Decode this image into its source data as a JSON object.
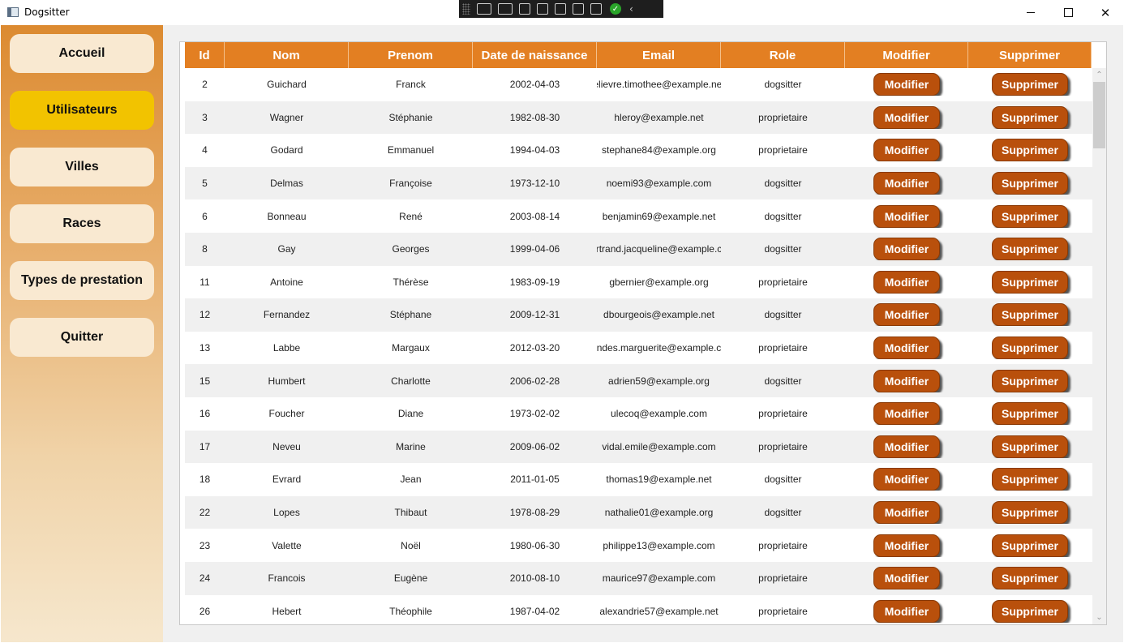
{
  "window": {
    "title": "Dogsitter"
  },
  "sidebar": {
    "items": [
      {
        "label": "Accueil",
        "active": false
      },
      {
        "label": "Utilisateurs",
        "active": true
      },
      {
        "label": "Villes",
        "active": false
      },
      {
        "label": "Races",
        "active": false
      },
      {
        "label": "Types de prestation",
        "active": false
      },
      {
        "label": "Quitter",
        "active": false
      }
    ]
  },
  "grid": {
    "columns": [
      "Id",
      "Nom",
      "Prenom",
      "Date de naissance",
      "Email",
      "Role",
      "Modifier",
      "Supprimer"
    ],
    "modify_label": "Modifier",
    "delete_label": "Supprimer",
    "rows": [
      {
        "id": "2",
        "nom": "Guichard",
        "prenom": "Franck",
        "date": "2002-04-03",
        "email": "elievre.timothee@example.net",
        "role": "dogsitter"
      },
      {
        "id": "3",
        "nom": "Wagner",
        "prenom": "Stéphanie",
        "date": "1982-08-30",
        "email": "hleroy@example.net",
        "role": "proprietaire"
      },
      {
        "id": "4",
        "nom": "Godard",
        "prenom": "Emmanuel",
        "date": "1994-04-03",
        "email": "stephane84@example.org",
        "role": "proprietaire"
      },
      {
        "id": "5",
        "nom": "Delmas",
        "prenom": "Françoise",
        "date": "1973-12-10",
        "email": "noemi93@example.com",
        "role": "dogsitter"
      },
      {
        "id": "6",
        "nom": "Bonneau",
        "prenom": "René",
        "date": "2003-08-14",
        "email": "benjamin69@example.net",
        "role": "dogsitter"
      },
      {
        "id": "8",
        "nom": "Gay",
        "prenom": "Georges",
        "date": "1999-04-06",
        "email": "rtrand.jacqueline@example.c",
        "role": "dogsitter"
      },
      {
        "id": "11",
        "nom": "Antoine",
        "prenom": "Thérèse",
        "date": "1983-09-19",
        "email": "gbernier@example.org",
        "role": "proprietaire"
      },
      {
        "id": "12",
        "nom": "Fernandez",
        "prenom": "Stéphane",
        "date": "2009-12-31",
        "email": "dbourgeois@example.net",
        "role": "dogsitter"
      },
      {
        "id": "13",
        "nom": "Labbe",
        "prenom": "Margaux",
        "date": "2012-03-20",
        "email": "ndes.marguerite@example.c",
        "role": "proprietaire"
      },
      {
        "id": "15",
        "nom": "Humbert",
        "prenom": "Charlotte",
        "date": "2006-02-28",
        "email": "adrien59@example.org",
        "role": "dogsitter"
      },
      {
        "id": "16",
        "nom": "Foucher",
        "prenom": "Diane",
        "date": "1973-02-02",
        "email": "ulecoq@example.com",
        "role": "proprietaire"
      },
      {
        "id": "17",
        "nom": "Neveu",
        "prenom": "Marine",
        "date": "2009-06-02",
        "email": "vidal.emile@example.com",
        "role": "proprietaire"
      },
      {
        "id": "18",
        "nom": "Evrard",
        "prenom": "Jean",
        "date": "2011-01-05",
        "email": "thomas19@example.net",
        "role": "dogsitter"
      },
      {
        "id": "22",
        "nom": "Lopes",
        "prenom": "Thibaut",
        "date": "1978-08-29",
        "email": "nathalie01@example.org",
        "role": "dogsitter"
      },
      {
        "id": "23",
        "nom": "Valette",
        "prenom": "Noël",
        "date": "1980-06-30",
        "email": "philippe13@example.com",
        "role": "proprietaire"
      },
      {
        "id": "24",
        "nom": "Francois",
        "prenom": "Eugène",
        "date": "2010-08-10",
        "email": "maurice97@example.com",
        "role": "proprietaire"
      },
      {
        "id": "26",
        "nom": "Hebert",
        "prenom": "Théophile",
        "date": "1987-04-02",
        "email": "alexandrie57@example.net",
        "role": "proprietaire"
      }
    ]
  },
  "colors": {
    "header": "#e37f22",
    "button": "#b9500c",
    "active_nav": "#f2c300",
    "nav": "#f9e9d1"
  }
}
